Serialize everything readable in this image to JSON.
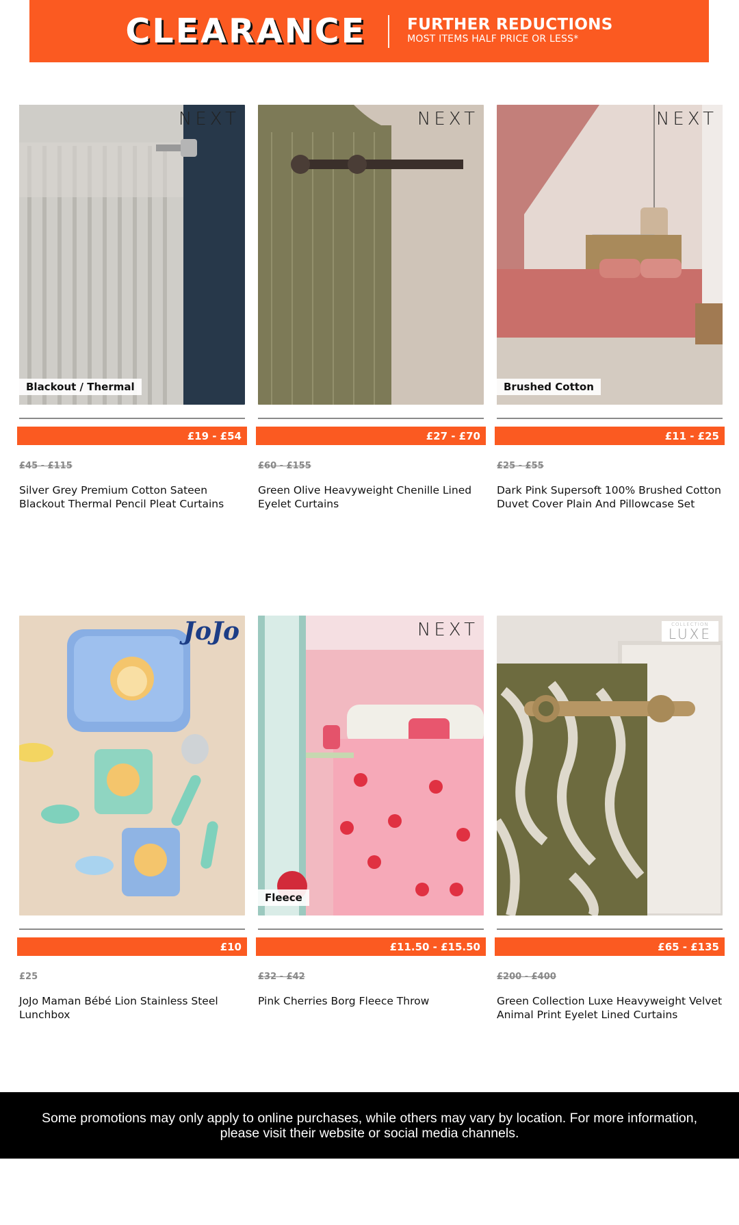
{
  "banner": {
    "title": "CLEARANCE",
    "subtitle": "FURTHER REDUCTIONS",
    "note": "MOST ITEMS HALF PRICE OR LESS*",
    "color": "#fb5a21"
  },
  "products": [
    {
      "brand": "NEXT",
      "tag": "Blackout / Thermal",
      "price": "£19 - £54",
      "was": "£45 - £115",
      "name": "Silver Grey Premium Cotton Sateen Blackout Thermal Pencil Pleat Curtains"
    },
    {
      "brand": "NEXT",
      "tag": "",
      "price": "£27 - £70",
      "was": "£60 - £155",
      "name": "Green Olive Heavyweight Chenille Lined Eyelet Curtains"
    },
    {
      "brand": "NEXT",
      "tag": "Brushed Cotton",
      "price": "£11 - £25",
      "was": "£25 - £55",
      "name": "Dark Pink Supersoft 100% Brushed Cotton Duvet Cover Plain And Pillowcase Set"
    },
    {
      "brand": "JoJo",
      "tag": "",
      "price": "£10",
      "was": "£25",
      "name": "JoJo Maman Bébé Lion Stainless Steel Lunchbox"
    },
    {
      "brand": "NEXT",
      "tag": "Fleece",
      "price": "£11.50 - £15.50",
      "was": "£32 - £42",
      "name": "Pink Cherries Borg Fleece Throw"
    },
    {
      "brand": "LUXE",
      "brand_small": "COLLECTION",
      "tag": "",
      "price": "£65 - £135",
      "was": "£200 - £400",
      "name": "Green Collection Luxe Heavyweight Velvet Animal Print Eyelet Lined Curtains"
    }
  ],
  "footer": {
    "text": "Some promotions may only apply to online purchases, while others may vary by location. For more information, please visit their website or social media channels."
  }
}
